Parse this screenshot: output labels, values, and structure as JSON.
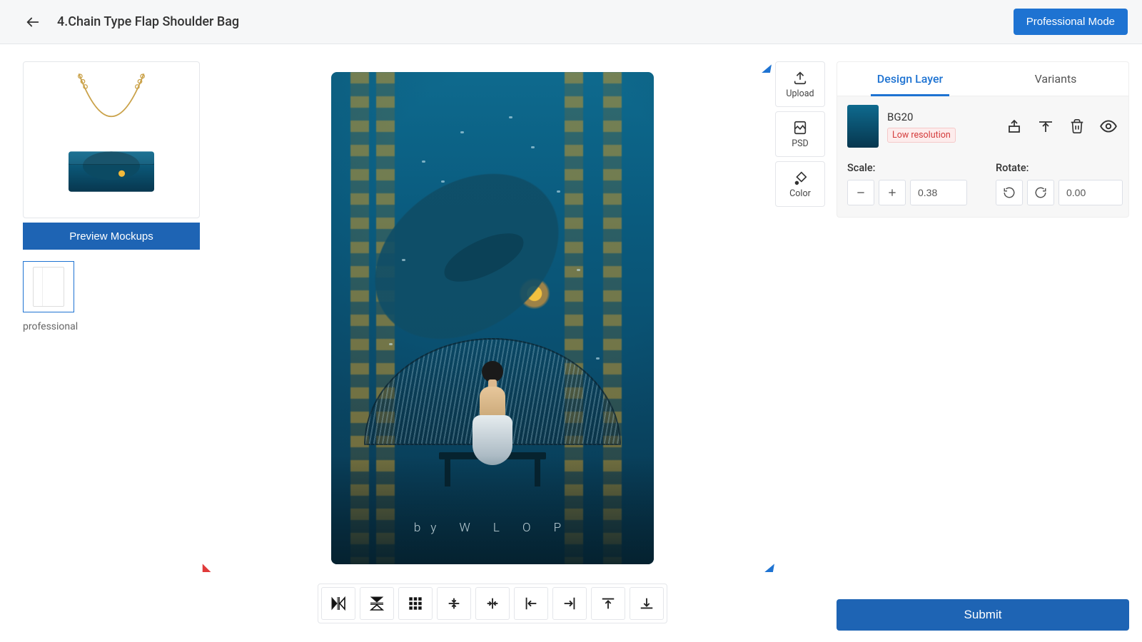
{
  "header": {
    "title": "4.Chain Type Flap Shoulder Bag",
    "pro_mode": "Professional Mode"
  },
  "left": {
    "preview_btn": "Preview Mockups",
    "template_label": "professional"
  },
  "vtools": {
    "upload": "Upload",
    "psd": "PSD",
    "color": "Color"
  },
  "artwork": {
    "byline": "by   W  L  O  P"
  },
  "right": {
    "tabs": {
      "design": "Design Layer",
      "variants": "Variants"
    },
    "layer": {
      "name": "BG20",
      "badge": "Low resolution"
    },
    "scale": {
      "label": "Scale:",
      "value": "0.38"
    },
    "rotate": {
      "label": "Rotate:",
      "value": "0.00"
    },
    "submit": "Submit"
  }
}
